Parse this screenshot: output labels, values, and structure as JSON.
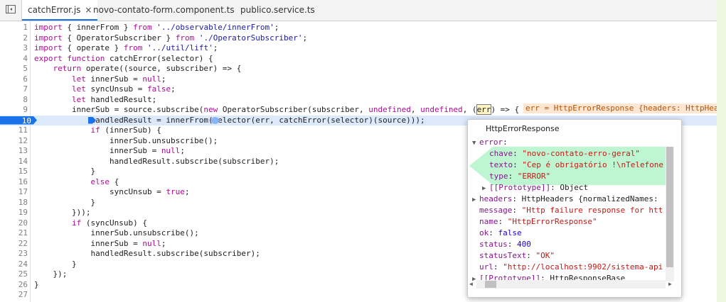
{
  "tabs": [
    {
      "label": "catchError.js",
      "active": true,
      "close": "×"
    },
    {
      "label": "novo-contato-form.component.ts",
      "active": false
    },
    {
      "label": "publico.service.ts",
      "active": false
    }
  ],
  "code_lines": [
    {
      "n": "1",
      "text": "import { innerFrom } from '../observable/innerFrom';"
    },
    {
      "n": "2",
      "text": "import { OperatorSubscriber } from './OperatorSubscriber';"
    },
    {
      "n": "3",
      "text": "import { operate } from '../util/lift';"
    },
    {
      "n": "4",
      "text": "export function catchError(selector) {"
    },
    {
      "n": "5",
      "text": "    return operate((source, subscriber) => {"
    },
    {
      "n": "6",
      "text": "        let innerSub = null;"
    },
    {
      "n": "7",
      "text": "        let syncUnsub = false;"
    },
    {
      "n": "8",
      "text": "        let handledResult;"
    },
    {
      "n": "9",
      "text": "        innerSub = source.subscribe(new OperatorSubscriber(subscriber, undefined, undefined, (err) => {"
    },
    {
      "n": "10",
      "text": "            handledResult = innerFrom(selector(err, catchError(selector)(source)));"
    },
    {
      "n": "11",
      "text": "            if (innerSub) {"
    },
    {
      "n": "12",
      "text": "                innerSub.unsubscribe();"
    },
    {
      "n": "13",
      "text": "                innerSub = null;"
    },
    {
      "n": "14",
      "text": "                handledResult.subscribe(subscriber);"
    },
    {
      "n": "15",
      "text": "            }"
    },
    {
      "n": "16",
      "text": "            else {"
    },
    {
      "n": "17",
      "text": "                syncUnsub = true;"
    },
    {
      "n": "18",
      "text": "            }"
    },
    {
      "n": "19",
      "text": "        }));"
    },
    {
      "n": "20",
      "text": "        if (syncUnsub) {"
    },
    {
      "n": "21",
      "text": "            innerSub.unsubscribe();"
    },
    {
      "n": "22",
      "text": "            innerSub = null;"
    },
    {
      "n": "23",
      "text": "            handledResult.subscribe(subscriber);"
    },
    {
      "n": "24",
      "text": "        }"
    },
    {
      "n": "25",
      "text": "    });"
    },
    {
      "n": "26",
      "text": "}"
    },
    {
      "n": "27",
      "text": ""
    }
  ],
  "breakpoint_line": "10",
  "inline_value": "err = HttpErrorResponse {headers: HttpHeaders",
  "popover": {
    "title": "HttpErrorResponse",
    "props": [
      {
        "indent": 0,
        "toggle": "▼",
        "key": "error",
        "sep": ":",
        "value": "",
        "vtype": "o"
      },
      {
        "indent": 1,
        "toggle": "",
        "key": "chave",
        "sep": ": ",
        "value": "\"novo-contato-erro-geral\"",
        "vtype": "s"
      },
      {
        "indent": 1,
        "toggle": "",
        "key": "texto",
        "sep": ": ",
        "value": "\"Cep é obrigatório !\\nTelefone",
        "vtype": "s"
      },
      {
        "indent": 1,
        "toggle": "",
        "key": "type",
        "sep": ": ",
        "value": "\"ERROR\"",
        "vtype": "s"
      },
      {
        "indent": 1,
        "toggle": "▶",
        "key": "[[Prototype]]",
        "sep": ": ",
        "value": "Object",
        "vtype": "o"
      },
      {
        "indent": 0,
        "toggle": "▶",
        "key": "headers",
        "sep": ": ",
        "value": "HttpHeaders {normalizedNames:",
        "vtype": "o"
      },
      {
        "indent": 0,
        "toggle": "",
        "key": "message",
        "sep": ": ",
        "value": "\"Http failure response for htt",
        "vtype": "s"
      },
      {
        "indent": 0,
        "toggle": "",
        "key": "name",
        "sep": ": ",
        "value": "\"HttpErrorResponse\"",
        "vtype": "s"
      },
      {
        "indent": 0,
        "toggle": "",
        "key": "ok",
        "sep": ": ",
        "value": "false",
        "vtype": "n"
      },
      {
        "indent": 0,
        "toggle": "",
        "key": "status",
        "sep": ": ",
        "value": "400",
        "vtype": "n"
      },
      {
        "indent": 0,
        "toggle": "",
        "key": "statusText",
        "sep": ": ",
        "value": "\"OK\"",
        "vtype": "s"
      },
      {
        "indent": 0,
        "toggle": "",
        "key": "url",
        "sep": ": ",
        "value": "\"http://localhost:9902/sistema-api",
        "vtype": "s"
      },
      {
        "indent": 0,
        "toggle": "▶",
        "key": "[[Prototype]]",
        "sep": ": ",
        "value": "HttpResponseBase",
        "vtype": "o"
      }
    ],
    "scroll_left_arrow": "◀",
    "scroll_right_arrow": "▶"
  },
  "colors": {
    "breakpoint": "#1a73e8",
    "highlight_green": "#86efac",
    "inline_value_bg": "#fde7d3"
  }
}
